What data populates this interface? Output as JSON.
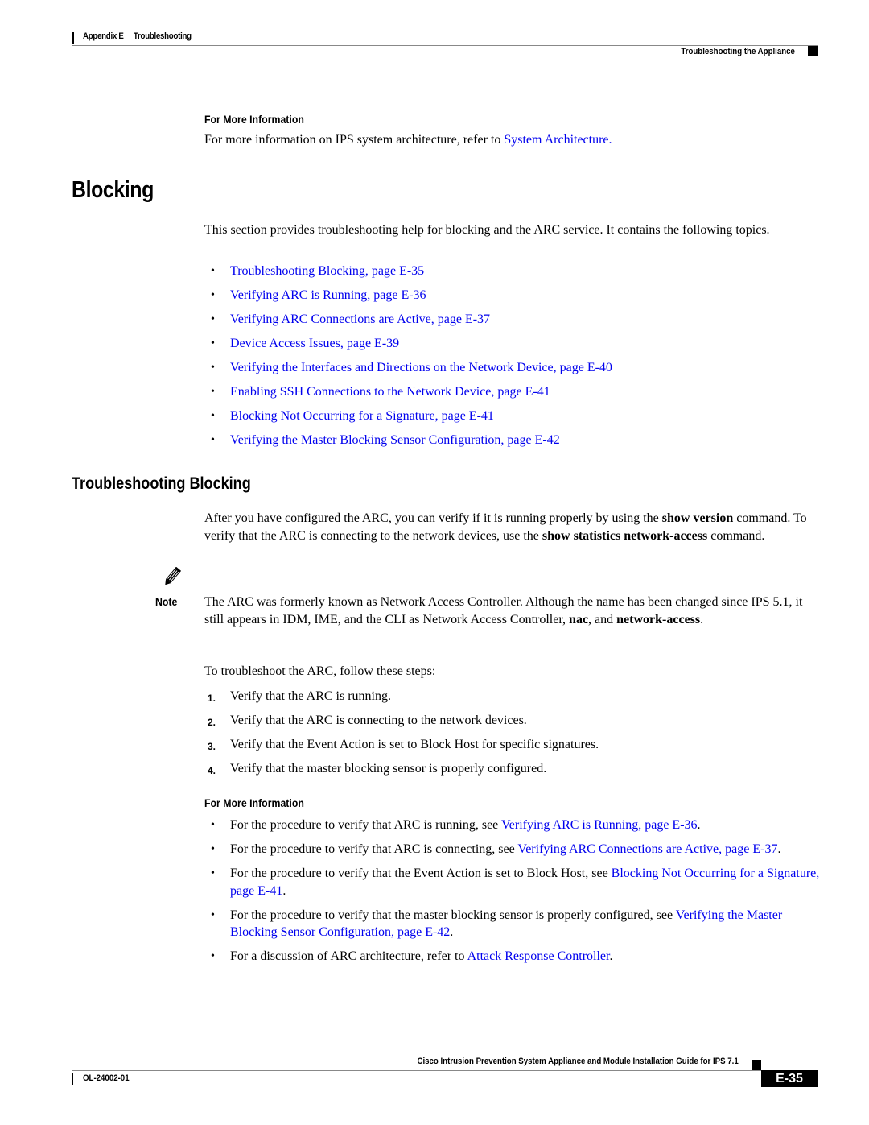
{
  "header": {
    "appendix": "Appendix E",
    "chapter": "Troubleshooting",
    "section": "Troubleshooting the Appliance"
  },
  "fmi_top": {
    "heading": "For More Information",
    "text_before": "For more information on IPS system architecture, refer to ",
    "link": "System Architecture",
    "text_after": "."
  },
  "blocking": {
    "title": "Blocking",
    "intro": "This section provides troubleshooting help for blocking and the ARC service. It contains the following topics.",
    "topics": [
      "Troubleshooting Blocking, page E-35",
      "Verifying ARC is Running, page E-36",
      "Verifying ARC Connections are Active, page E-37",
      "Device Access Issues, page E-39",
      "Verifying the Interfaces and Directions on the Network Device, page E-40",
      "Enabling SSH Connections to the Network Device, page E-41",
      "Blocking Not Occurring for a Signature, page E-41",
      "Verifying the Master Blocking Sensor Configuration, page E-42"
    ],
    "bullet": "•"
  },
  "troubleshooting": {
    "title": "Troubleshooting Blocking",
    "p1_a": "After you have configured the ARC, you can verify if it is running properly by using the ",
    "p1_b": "show version",
    "p1_c": " command. To verify that the ARC is connecting to the network devices, use the ",
    "p1_d": "show statistics network-access",
    "p1_e": " command.",
    "note_label": "Note",
    "note_a": "The ARC was formerly known as Network Access Controller. Although the name has been changed since IPS 5.1, it still appears in IDM, IME, and the CLI as Network Access Controller, ",
    "note_b": "nac",
    "note_c": ", and ",
    "note_d": "network-access",
    "note_e": ".",
    "steps_intro": "To troubleshoot the ARC, follow these steps:",
    "steps": [
      {
        "num": "1.",
        "text": "Verify that the ARC is running."
      },
      {
        "num": "2.",
        "text": "Verify that the ARC is connecting to the network devices."
      },
      {
        "num": "3.",
        "text": "Verify that the Event Action is set to Block Host for specific signatures."
      },
      {
        "num": "4.",
        "text": "Verify that the master blocking sensor is properly configured."
      }
    ]
  },
  "fmi_bottom": {
    "heading": "For More Information",
    "items": [
      {
        "text": "For the procedure to verify that ARC is running, see ",
        "link": "Verifying ARC is Running, page E-36",
        "after": "."
      },
      {
        "text": "For the procedure to verify that ARC is connecting, see ",
        "link": "Verifying ARC Connections are Active, page E-37",
        "after": "."
      },
      {
        "text": "For the procedure to verify that the Event Action is set to Block Host, see ",
        "link": "Blocking Not Occurring for a Signature, page E-41",
        "after": "."
      },
      {
        "text": "For the procedure to verify that the master blocking sensor is properly configured, see ",
        "link": "Verifying the Master Blocking Sensor Configuration, page E-42",
        "after": "."
      },
      {
        "text": "For a discussion of ARC architecture, refer to ",
        "link": "Attack Response Controller",
        "after": "."
      }
    ]
  },
  "footer": {
    "title": "Cisco Intrusion Prevention System Appliance and Module Installation Guide for IPS 7.1",
    "doc_number": "OL-24002-01",
    "page": "E-35"
  },
  "colors": {
    "link": "#0000ee",
    "text": "#000000"
  }
}
